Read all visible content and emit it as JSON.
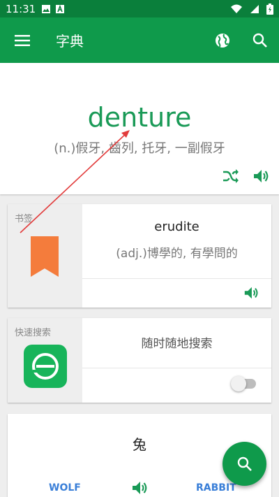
{
  "status_bar": {
    "time": "11:31"
  },
  "app_bar": {
    "title": "字典"
  },
  "hero": {
    "word": "denture",
    "definition": "(n.)假牙, 齒列, 托牙, 一副假牙"
  },
  "bookmark_card": {
    "label": "书签",
    "word": "erudite",
    "definition": "(adj.)博學的, 有學問的"
  },
  "quick_search_card": {
    "label": "快速搜索",
    "text": "随时随地搜索",
    "toggle_on": false
  },
  "word_card": {
    "character": "兔",
    "left_link": "WOLF",
    "right_link": "RABBIT"
  },
  "colors": {
    "primary": "#0f9a4b",
    "primary_dark": "#0a7f3b",
    "word_green": "#1a9a57",
    "bookmark_orange": "#f47c3c",
    "link_blue": "#3a7fd8"
  },
  "icons": [
    "menu-icon",
    "globe-icon",
    "search-icon",
    "shuffle-icon",
    "speaker-icon",
    "bookmark-icon",
    "app-logo-icon",
    "fab-search-icon"
  ]
}
